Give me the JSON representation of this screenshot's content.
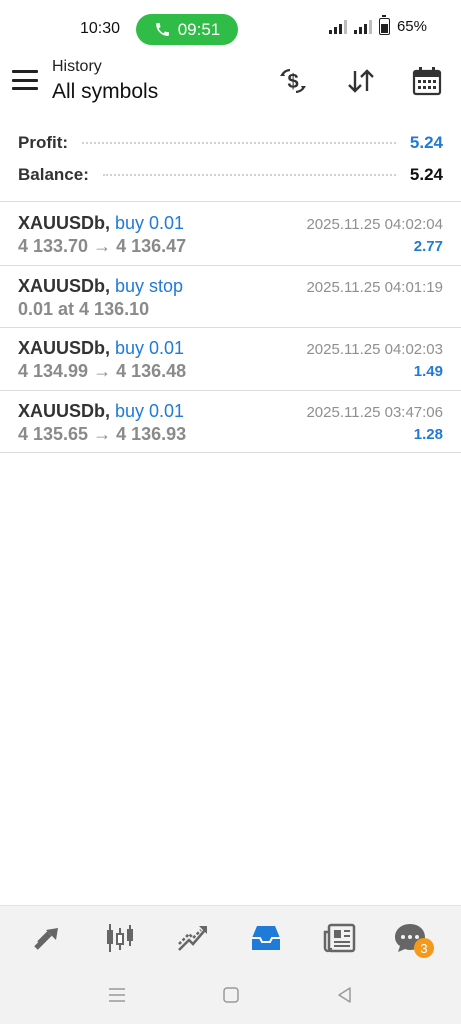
{
  "status_bar": {
    "time": "10:30",
    "call_time": "09:51",
    "battery": "65%"
  },
  "header": {
    "subtitle": "History",
    "title": "All symbols",
    "icons": [
      "currency-exchange-icon",
      "sort-icon",
      "calendar-icon"
    ]
  },
  "summary": {
    "profit_label": "Profit:",
    "profit_value": "5.24",
    "balance_label": "Balance:",
    "balance_value": "5.24"
  },
  "rows": [
    {
      "symbol": "XAUUSDb,",
      "deal": " buy 0.01",
      "prices": "4 133.70 → 4 136.47",
      "time": "2025.11.25 04:02:04",
      "profit": "2.77"
    },
    {
      "symbol": "XAUUSDb,",
      "deal": " buy stop",
      "prices": "0.01 at 4 136.10",
      "time": "2025.11.25 04:01:19",
      "profit": ""
    },
    {
      "symbol": "XAUUSDb,",
      "deal": " buy 0.01",
      "prices": "4 134.99 → 4 136.48",
      "time": "2025.11.25 04:02:03",
      "profit": "1.49"
    },
    {
      "symbol": "XAUUSDb,",
      "deal": " buy 0.01",
      "prices": "4 135.65 → 4 136.93",
      "time": "2025.11.25 03:47:06",
      "profit": "1.28"
    }
  ],
  "bottom_nav": {
    "items": [
      "quotes-icon",
      "chart-icon",
      "trade-icon",
      "history-icon",
      "news-icon",
      "chat-icon"
    ],
    "active": "history-icon",
    "chat_badge": "3"
  },
  "colors": {
    "accent_blue": "#1f7ad8",
    "call_green": "#2fbd48",
    "badge_orange": "#f39a1d"
  }
}
